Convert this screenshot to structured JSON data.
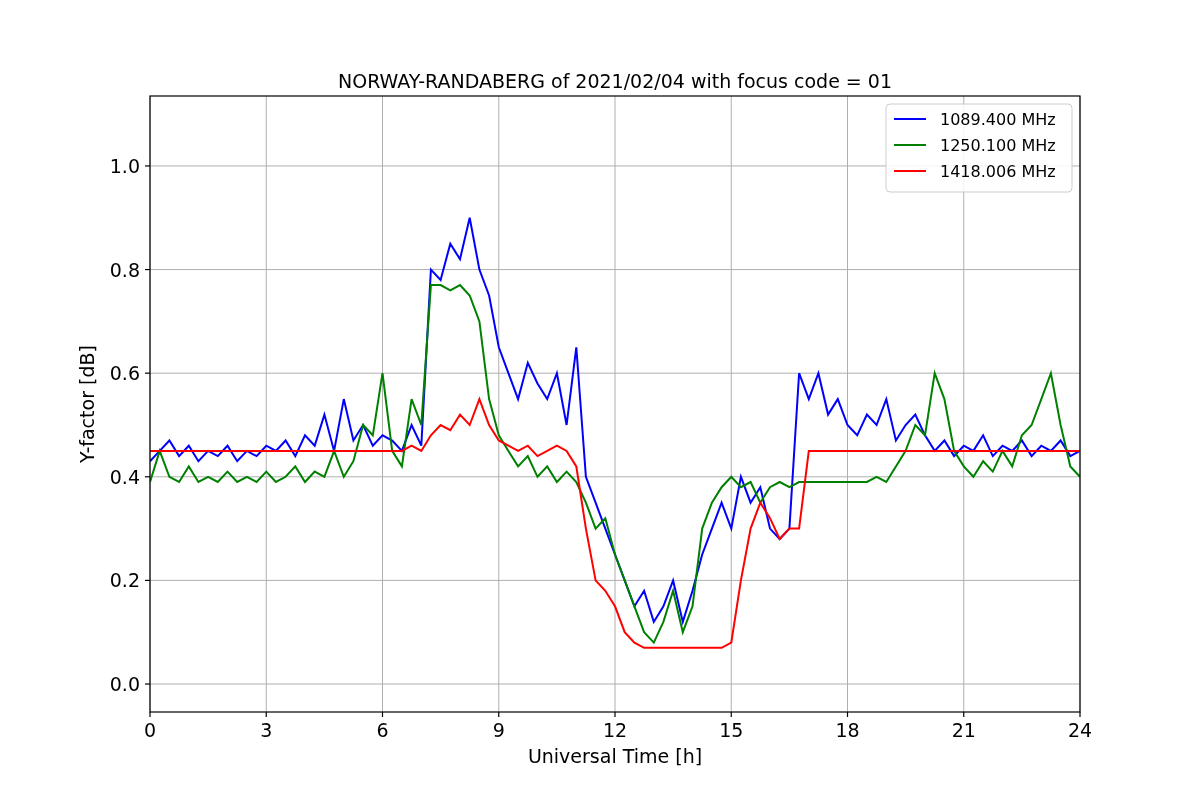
{
  "figure": {
    "chart_data": {
      "type": "line",
      "title": "NORWAY-RANDABERG of 2021/02/04 with focus code = 01",
      "xlabel": "Universal Time [h]",
      "ylabel": "Y-factor [dB]",
      "x": [
        0,
        0.25,
        0.5,
        0.75,
        1,
        1.25,
        1.5,
        1.75,
        2,
        2.25,
        2.5,
        2.75,
        3,
        3.25,
        3.5,
        3.75,
        4,
        4.25,
        4.5,
        4.75,
        5,
        5.25,
        5.5,
        5.75,
        6,
        6.25,
        6.5,
        6.75,
        7,
        7.25,
        7.5,
        7.75,
        8,
        8.25,
        8.5,
        8.75,
        9,
        9.25,
        9.5,
        9.75,
        10,
        10.25,
        10.5,
        10.75,
        11,
        11.25,
        11.5,
        11.75,
        12,
        12.25,
        12.5,
        12.75,
        13,
        13.25,
        13.5,
        13.75,
        14,
        14.25,
        14.5,
        14.75,
        15,
        15.25,
        15.5,
        15.75,
        16,
        16.25,
        16.5,
        16.75,
        17,
        17.25,
        17.5,
        17.75,
        18,
        18.25,
        18.5,
        18.75,
        19,
        19.25,
        19.5,
        19.75,
        20,
        20.25,
        20.5,
        20.75,
        21,
        21.25,
        21.5,
        21.75,
        22,
        22.25,
        22.5,
        22.75,
        23,
        23.25,
        23.5,
        23.75,
        24
      ],
      "series": [
        {
          "name": "1089.400 MHz",
          "color": "#0000ff",
          "values": [
            0.43,
            0.45,
            0.47,
            0.44,
            0.46,
            0.43,
            0.45,
            0.44,
            0.46,
            0.43,
            0.45,
            0.44,
            0.46,
            0.45,
            0.47,
            0.44,
            0.48,
            0.46,
            0.52,
            0.45,
            0.55,
            0.47,
            0.5,
            0.46,
            0.48,
            0.47,
            0.45,
            0.5,
            0.46,
            0.8,
            0.78,
            0.85,
            0.82,
            0.9,
            0.8,
            0.75,
            0.65,
            0.6,
            0.55,
            0.62,
            0.58,
            0.55,
            0.6,
            0.5,
            0.65,
            0.4,
            0.35,
            0.3,
            0.25,
            0.2,
            0.15,
            0.18,
            0.12,
            0.15,
            0.2,
            0.12,
            0.18,
            0.25,
            0.3,
            0.35,
            0.3,
            0.4,
            0.35,
            0.38,
            0.3,
            0.28,
            0.3,
            0.6,
            0.55,
            0.6,
            0.52,
            0.55,
            0.5,
            0.48,
            0.52,
            0.5,
            0.55,
            0.47,
            0.5,
            0.52,
            0.48,
            0.45,
            0.47,
            0.44,
            0.46,
            0.45,
            0.48,
            0.44,
            0.46,
            0.45,
            0.47,
            0.44,
            0.46,
            0.45,
            0.47,
            0.44,
            0.45
          ]
        },
        {
          "name": "1250.100 MHz",
          "color": "#008000",
          "values": [
            0.39,
            0.45,
            0.4,
            0.39,
            0.42,
            0.39,
            0.4,
            0.39,
            0.41,
            0.39,
            0.4,
            0.39,
            0.41,
            0.39,
            0.4,
            0.42,
            0.39,
            0.41,
            0.4,
            0.45,
            0.4,
            0.43,
            0.5,
            0.48,
            0.6,
            0.45,
            0.42,
            0.55,
            0.5,
            0.77,
            0.77,
            0.76,
            0.77,
            0.75,
            0.7,
            0.55,
            0.48,
            0.45,
            0.42,
            0.44,
            0.4,
            0.42,
            0.39,
            0.41,
            0.39,
            0.35,
            0.3,
            0.32,
            0.25,
            0.2,
            0.15,
            0.1,
            0.08,
            0.12,
            0.18,
            0.1,
            0.15,
            0.3,
            0.35,
            0.38,
            0.4,
            0.38,
            0.39,
            0.35,
            0.38,
            0.39,
            0.38,
            0.39,
            0.39,
            0.39,
            0.39,
            0.39,
            0.39,
            0.39,
            0.39,
            0.4,
            0.39,
            0.42,
            0.45,
            0.5,
            0.48,
            0.6,
            0.55,
            0.45,
            0.42,
            0.4,
            0.43,
            0.41,
            0.45,
            0.42,
            0.48,
            0.5,
            0.55,
            0.6,
            0.5,
            0.42,
            0.4
          ]
        },
        {
          "name": "1418.006 MHz",
          "color": "#ff0000",
          "values": [
            0.45,
            0.45,
            0.45,
            0.45,
            0.45,
            0.45,
            0.45,
            0.45,
            0.45,
            0.45,
            0.45,
            0.45,
            0.45,
            0.45,
            0.45,
            0.45,
            0.45,
            0.45,
            0.45,
            0.45,
            0.45,
            0.45,
            0.45,
            0.45,
            0.45,
            0.45,
            0.45,
            0.46,
            0.45,
            0.48,
            0.5,
            0.49,
            0.52,
            0.5,
            0.55,
            0.5,
            0.47,
            0.46,
            0.45,
            0.46,
            0.44,
            0.45,
            0.46,
            0.45,
            0.42,
            0.3,
            0.2,
            0.18,
            0.15,
            0.1,
            0.08,
            0.07,
            0.07,
            0.07,
            0.07,
            0.07,
            0.07,
            0.07,
            0.07,
            0.07,
            0.08,
            0.2,
            0.3,
            0.35,
            0.32,
            0.28,
            0.3,
            0.3,
            0.45,
            0.45,
            0.45,
            0.45,
            0.45,
            0.45,
            0.45,
            0.45,
            0.45,
            0.45,
            0.45,
            0.45,
            0.45,
            0.45,
            0.45,
            0.45,
            0.45,
            0.45,
            0.45,
            0.45,
            0.45,
            0.45,
            0.45,
            0.45,
            0.45,
            0.45,
            0.45,
            0.45,
            0.45
          ]
        }
      ],
      "xlim": [
        0,
        24
      ],
      "ylim": [
        -0.054,
        1.135
      ],
      "grid": true,
      "legend": true,
      "xticks": [
        0,
        3,
        6,
        9,
        12,
        15,
        18,
        21,
        24
      ],
      "yticks": [
        {
          "value": 0,
          "label": "0.0"
        },
        {
          "value": 0.2,
          "label": "0.2"
        },
        {
          "value": 0.4,
          "label": "0.4"
        },
        {
          "value": 0.6,
          "label": "0.6"
        },
        {
          "value": 0.8,
          "label": "0.8"
        },
        {
          "value": 1,
          "label": "1.0"
        }
      ]
    }
  }
}
